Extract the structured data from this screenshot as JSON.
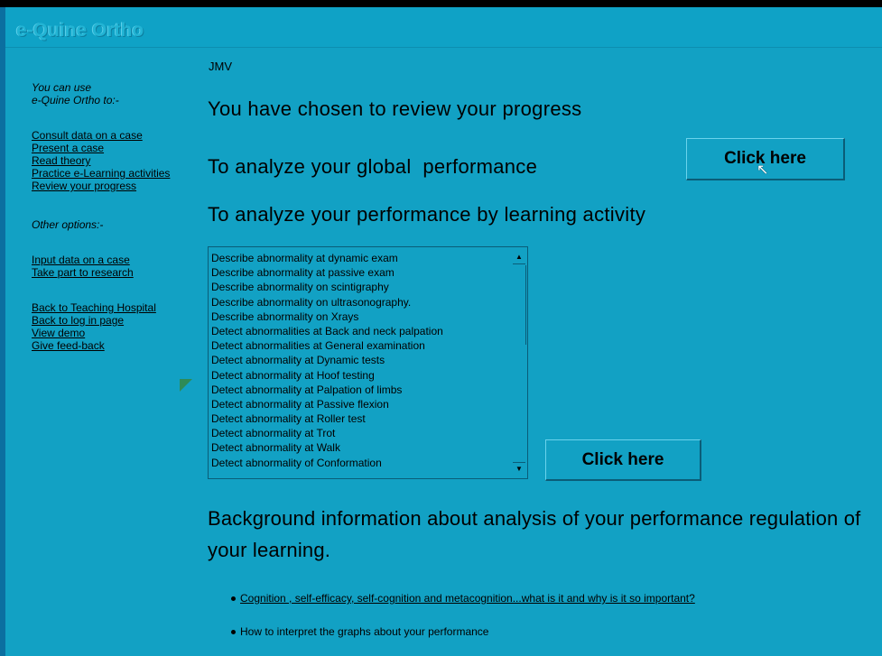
{
  "header": {
    "brand": "e-Quine Ortho"
  },
  "sidebar": {
    "intro_line1": "You can use",
    "intro_line2": "e-Quine Ortho to:-",
    "main_links": [
      "Consult data on a case",
      "Present a case",
      "Read theory",
      "Practice e-Learning activities",
      "Review your progress"
    ],
    "other_label": "Other options:-",
    "other_links": [
      "Input data on a case",
      "Take part to research"
    ],
    "bottom_links": [
      "Back to Teaching Hospital",
      "Back to log in page",
      "View demo",
      "Give feed-back"
    ]
  },
  "main": {
    "user": "JMV",
    "heading_review": "You have chosen to review your progress",
    "heading_global": "To analyze your global  performance",
    "global_button": "Click here",
    "heading_activity": "To analyze your performance by learning activity",
    "activity_button": "Click here",
    "activities": [
      "Describe abnormality at dynamic exam",
      "Describe abnormality at passive exam",
      "Describe abnormality on scintigraphy",
      "Describe abnormality on ultrasonography.",
      "Describe abnormality on Xrays",
      "Detect abnormalities at Back and neck palpation",
      "Detect abnormalities at General examination",
      "Detect abnormality at Dynamic tests",
      "Detect abnormality at Hoof testing",
      "Detect abnormality at Palpation of limbs",
      "Detect abnormality at Passive flexion",
      "Detect abnormality at Roller test",
      "Detect abnormality at Trot",
      "Detect abnormality at Walk",
      "Detect abnormality of Conformation"
    ],
    "background_heading": "Background information about analysis of your performance regulation of your learning.",
    "bullet_link": "Cognition , self-efficacy, self-cognition and metacognition...what is it and why is it so important?",
    "bullet_text": "How to interpret the graphs about your performance"
  },
  "colors": {
    "background": "#12a1c4",
    "top_bar": "#000000",
    "accent_triangle": "#2e8b57"
  }
}
